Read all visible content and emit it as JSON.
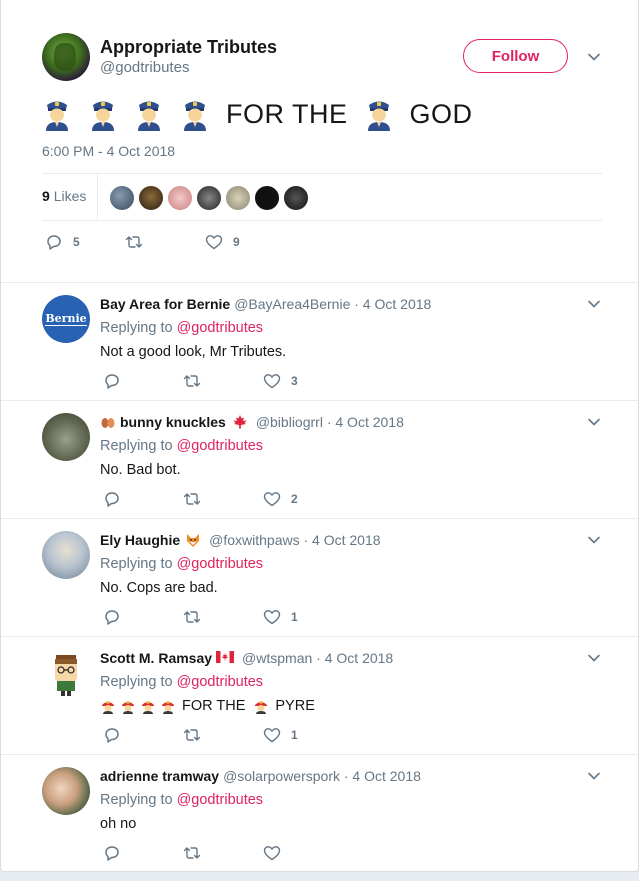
{
  "main_tweet": {
    "author_name": "Appropriate Tributes",
    "author_handle": "@godtributes",
    "follow_label": "Follow",
    "text_word_1": "FOR THE",
    "text_word_2": "GOD",
    "timestamp": "6:00 PM - 4 Oct 2018",
    "likes_count": "9",
    "likes_label": "Likes",
    "reply_count": "5",
    "retweet_count": "",
    "like_count": "9"
  },
  "replies": [
    {
      "name": "Bay Area for Bernie",
      "meta": "@BayArea4Bernie · 4 Oct 2018",
      "replying_prefix": "Replying to",
      "mention": "@godtributes",
      "text": "Not a good look, Mr Tributes.",
      "likes": "3",
      "avatar_text": "Bernie"
    },
    {
      "name": "bunny knuckles",
      "meta": "@bibliogrrl · 4 Oct 2018",
      "replying_prefix": "Replying to",
      "mention": "@godtributes",
      "text": "No. Bad bot.",
      "likes": "2"
    },
    {
      "name": "Ely Haughie",
      "meta": "@foxwithpaws · 4 Oct 2018",
      "replying_prefix": "Replying to",
      "mention": "@godtributes",
      "text": "No. Cops are bad.",
      "likes": "1"
    },
    {
      "name": "Scott M. Ramsay",
      "meta": "@wtspman · 4 Oct 2018",
      "replying_prefix": "Replying to",
      "mention": "@godtributes",
      "text_word_1": "FOR THE",
      "text_word_2": "PYRE",
      "likes": "1"
    },
    {
      "name": "adrienne tramway",
      "meta": "@solarpowerspork · 4 Oct 2018",
      "replying_prefix": "Replying to",
      "mention": "@godtributes",
      "text": "oh no",
      "likes": ""
    }
  ],
  "colors": {
    "accent": "#e0245e",
    "secondary_text": "#657786",
    "primary_text": "#14171a",
    "divider": "#e6ecf0"
  },
  "icons": [
    "chevron-down-icon",
    "reply-icon",
    "retweet-icon",
    "heart-icon",
    "police-officer-emoji",
    "firefighter-emoji",
    "fox-emoji",
    "maple-leaf-emoji",
    "canada-flag-emoji",
    "hands-emoji"
  ]
}
